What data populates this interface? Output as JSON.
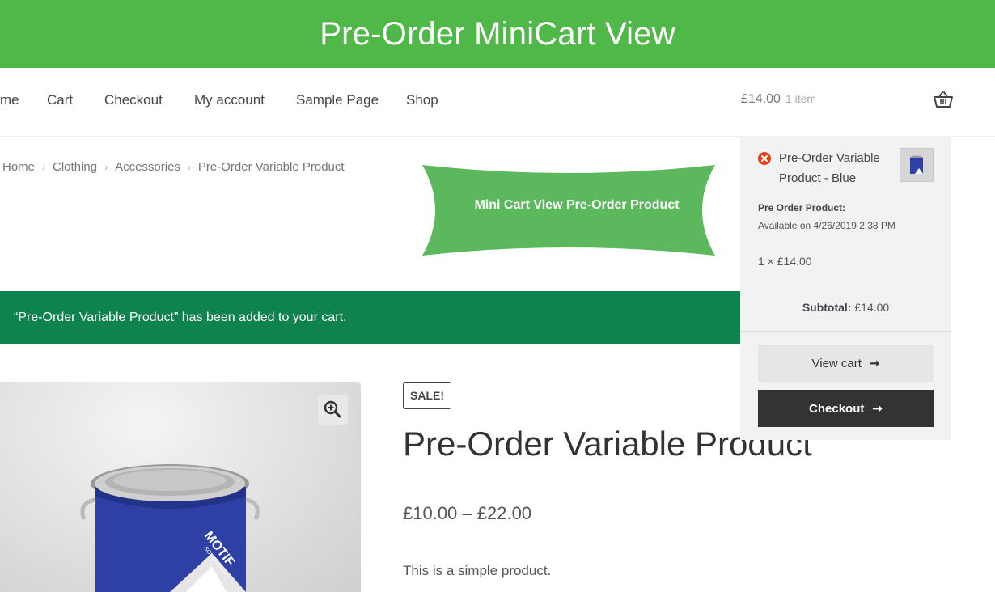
{
  "banner": {
    "title": "Pre-Order MiniCart View"
  },
  "nav": {
    "items": [
      "me",
      "Cart",
      "Checkout",
      "My account",
      "Sample Page",
      "Shop"
    ],
    "cart_total": "£14.00",
    "cart_count": "1 item"
  },
  "breadcrumb": {
    "items": [
      "Home",
      "Clothing",
      "Accessories",
      "Pre-Order Variable Product"
    ],
    "separator": "›"
  },
  "callout": {
    "text": "Mini Cart View Pre-Order Product"
  },
  "notice": {
    "message": "“Pre-Order Variable Product” has been added to your cart."
  },
  "product": {
    "sale_badge": "SALE!",
    "title": "Pre-Order Variable Product",
    "price": "£10.00 – £22.00",
    "description": "This is a simple product.",
    "image_brand": "MOTIF",
    "image_subbrand": "SOLUTIONS"
  },
  "minicart": {
    "item_name": "Pre-Order Variable Product - Blue",
    "preorder_label": "Pre Order Product:",
    "availability": "Available on 4/26/2019 2:38 PM",
    "quantity_line": "1 × £14.00",
    "subtotal_label": "Subtotal:",
    "subtotal_value": "£14.00",
    "view_cart_label": "View cart",
    "checkout_label": "Checkout",
    "arrow": "➞"
  },
  "colors": {
    "banner": "#50b848",
    "notice": "#0f834d",
    "callout": "#5cb85c",
    "checkout_button": "#333333",
    "remove_icon": "#e2401c",
    "can_blue": "#2e3fa6"
  },
  "icons": [
    "basket-icon",
    "breadcrumb-separator-icon",
    "zoom-icon",
    "remove-icon",
    "arrow-right-icon"
  ]
}
